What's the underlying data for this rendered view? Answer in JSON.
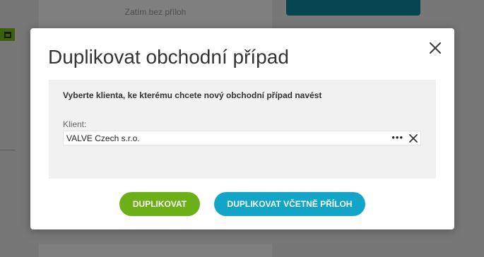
{
  "background": {
    "no_attachments_text": "Zatím bez příloh"
  },
  "modal": {
    "title": "Duplikovat obchodní případ",
    "instruction": "Vyberte klienta, ke kterému chcete nový obchodní případ navést",
    "client_label": "Klient:",
    "client_value": "VALVE Czech s.r.o.",
    "more_label": "•••",
    "buttons": {
      "duplicate": "DUPLIKOVAT",
      "duplicate_with_attachments": "DUPLIKOVAT VČETNĚ PŘÍLOH"
    }
  },
  "colors": {
    "green": "#6bb017",
    "blue": "#13a5c8",
    "teal": "#0b8b9f"
  },
  "icons": [
    "close-icon",
    "more-icon",
    "clear-icon",
    "calendar-icon"
  ]
}
